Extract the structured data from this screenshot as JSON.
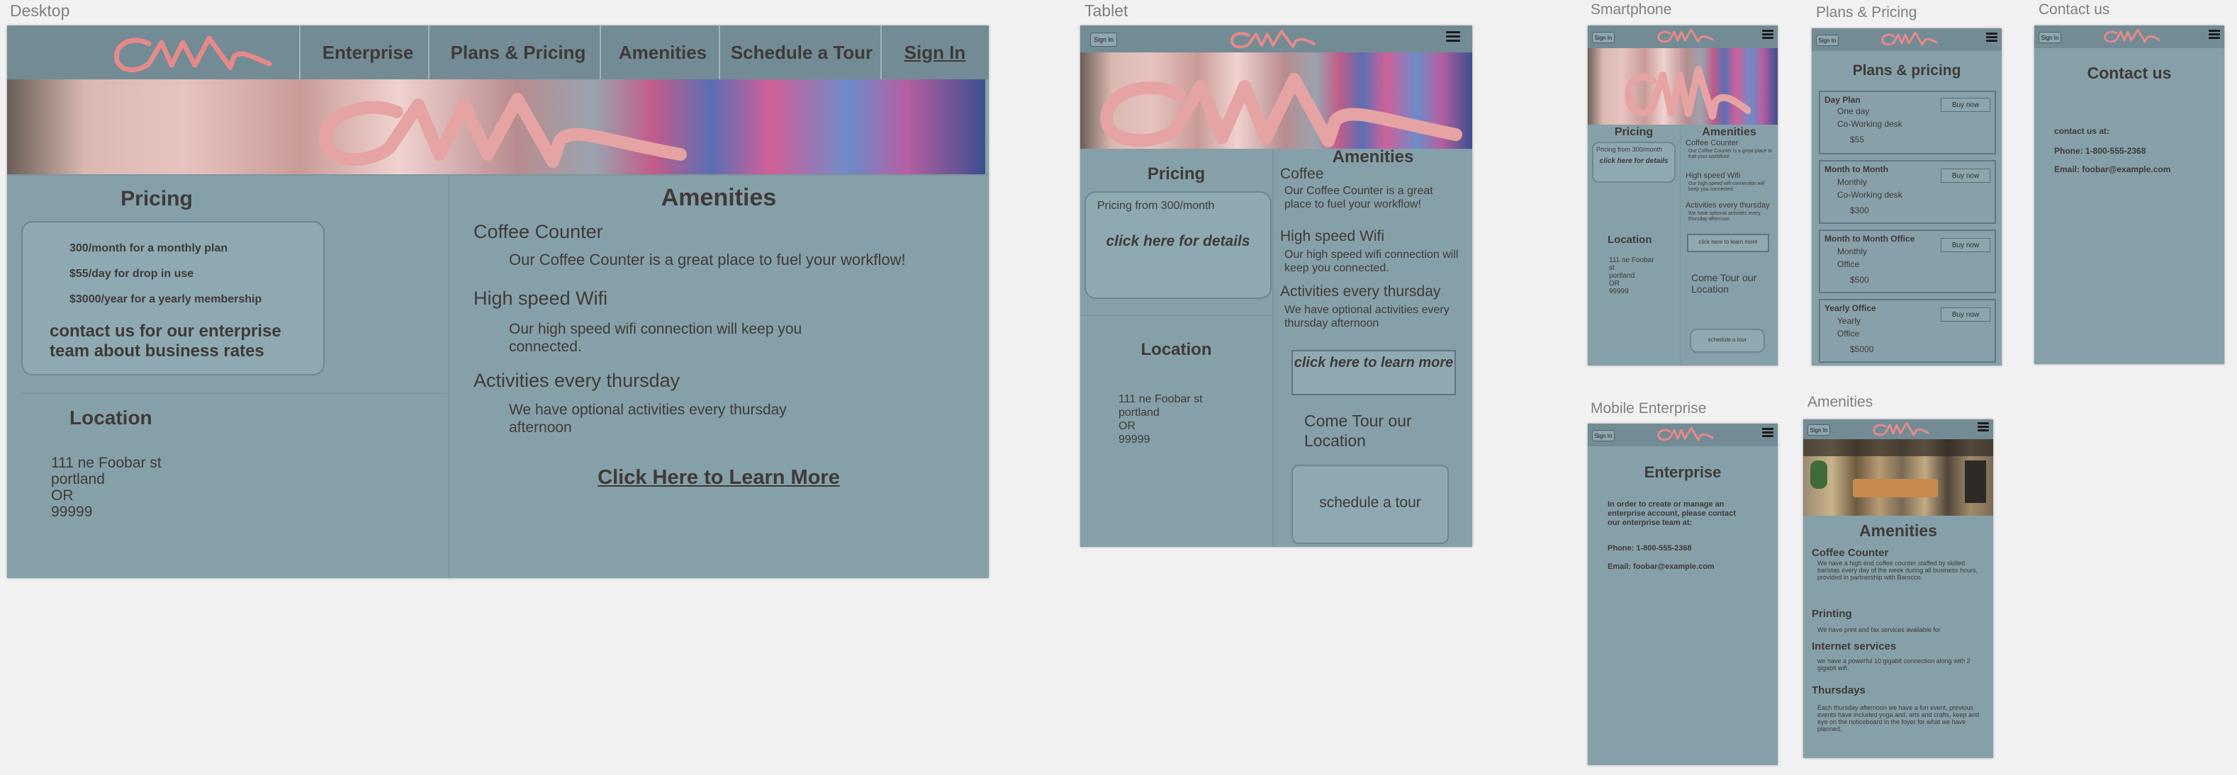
{
  "artboards": {
    "desktop": "Desktop",
    "tablet": "Tablet",
    "smartphone": "Smartphone",
    "plans": "Plans & Pricing",
    "contact": "Contact us",
    "mobile_enterprise": "Mobile Enterprise",
    "amenities": "Amenities"
  },
  "brand": {
    "logo_text": "CWN",
    "logo_color": "#e5898a",
    "bg_color": "#86a0a9",
    "nav_color": "#738b95"
  },
  "desktop": {
    "nav": [
      "Enterprise",
      "Plans & Pricing",
      "Amenities",
      "Schedule a Tour",
      "Sign In"
    ],
    "pricing": {
      "title": "Pricing",
      "items": [
        "300/month for a monthly plan",
        "$55/day for drop in use",
        "$3000/year for a yearly membership"
      ],
      "contact": "contact us for our enterprise team about business rates"
    },
    "location": {
      "title": "Location",
      "address": "111 ne Foobar st\nportland\nOR\n99999"
    },
    "amenities": {
      "title": "Amenities",
      "items": [
        {
          "title": "Coffee Counter",
          "text": "Our Coffee Counter is a great place to fuel your workflow!"
        },
        {
          "title": "High speed Wifi",
          "text": "Our high speed wifi connection will keep you connected."
        },
        {
          "title": "Activities every thursday",
          "text": "We have optional activities every thursday afternoon"
        }
      ],
      "link": "Click Here to Learn More"
    }
  },
  "tablet": {
    "sign_in": "Sign In",
    "pricing": {
      "title": "Pricing",
      "text": "Pricing from 300/month",
      "cta": "click here for details"
    },
    "location": {
      "title": "Location",
      "address": "111 ne Foobar st\nportland\nOR\n99999"
    },
    "amenities": {
      "title": "Amenities",
      "items": [
        {
          "title": "Coffee",
          "text": "Our Coffee Counter is a great place to fuel your workflow!"
        },
        {
          "title": "High speed Wifi",
          "text": "Our high speed wifi connection will keep you connected."
        },
        {
          "title": "Activities every thursday",
          "text": "We have optional activities every thursday afternoon"
        }
      ],
      "cta": "click here to learn more"
    },
    "tour": {
      "text": "Come Tour our Location",
      "button": "schedule a tour"
    }
  },
  "smartphone": {
    "sign_in": "Sign In",
    "pricing": {
      "title": "Pricing",
      "text": "Pricing from 300/month",
      "cta": "click here for details"
    },
    "location": {
      "title": "Location",
      "address": "111 ne Foobar\nst\nportland\nOR\n99999"
    },
    "amenities": {
      "title": "Amenities",
      "items": [
        {
          "title": "Coffee Counter",
          "text": "Our Coffee Counter is a great place to fuel your workflow!"
        },
        {
          "title": "High speed Wifi",
          "text": "Our high speed wifi connection will keep you connected."
        },
        {
          "title": "Activities every thursday",
          "text": "We have optional activities every thursday afternoon"
        }
      ],
      "cta": "click here to learn more"
    },
    "tour": {
      "text": "Come Tour our Location",
      "button": "schedule a tour"
    }
  },
  "plans": {
    "sign_in": "Sign In",
    "title": "Plans & pricing",
    "buy_label": "Buy now",
    "cards": [
      {
        "name": "Day Plan",
        "lines": [
          "One day",
          "Co-Working desk"
        ],
        "price": "$55"
      },
      {
        "name": "Month to Month",
        "lines": [
          "Monthly",
          "Co-Working desk"
        ],
        "price": "$300"
      },
      {
        "name": "Month to Month Office",
        "lines": [
          "Monthly",
          "Office"
        ],
        "price": "$500"
      },
      {
        "name": "Yearly Office",
        "lines": [
          "Yearly",
          "Office"
        ],
        "price": "$5000"
      }
    ]
  },
  "contact": {
    "sign_in": "Sign In",
    "title": "Contact us",
    "label": "contact us at:",
    "phone": "Phone: 1-800-555-2368",
    "email": "Email: foobar@example.com"
  },
  "enterprise": {
    "sign_in": "Sign In",
    "title": "Enterprise",
    "text": "In order to create or manage an enterprise account, please contact our enterprise team at:",
    "phone": "Phone: 1-800-555-2368",
    "email": "Email: foobar@example.com"
  },
  "amenities_page": {
    "sign_in": "Sign In",
    "title": "Amenities",
    "sections": [
      {
        "title": "Coffee Counter",
        "text": "We have a high end coffee counter staffed by skilled baristas every day of the week during all business hours, provided in partnership with Barocco."
      },
      {
        "title": "Printing",
        "text": "We have print and fax services available for"
      },
      {
        "title": "Internet services",
        "text": "we have a powerful 10 gigabit connection along with 2 gigabit wifi."
      },
      {
        "title": "Thursdays",
        "text": "Each thursday afternoon we have a fun event, previous events have included yoga and, arts and crafts, keep and eye on the noticeboard in the foyer for what we have planned."
      }
    ]
  }
}
